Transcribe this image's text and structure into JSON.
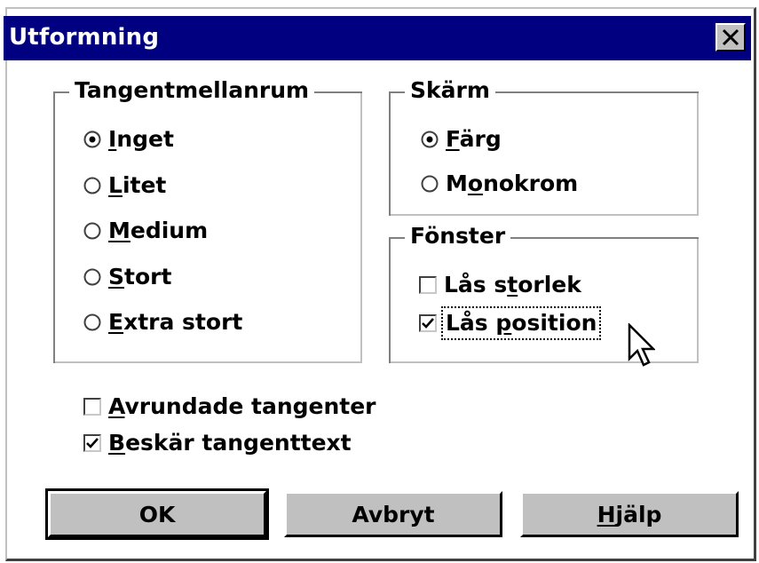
{
  "window": {
    "title": "Utformning",
    "close_label": "×",
    "close_icon": "close-x-icon"
  },
  "key_spacing": {
    "legend": "Tangentmellanrum",
    "options": [
      {
        "pre": "",
        "key": "I",
        "post": "nget",
        "selected": true
      },
      {
        "pre": "",
        "key": "L",
        "post": "itet",
        "selected": false
      },
      {
        "pre": "",
        "key": "M",
        "post": "edium",
        "selected": false
      },
      {
        "pre": "",
        "key": "S",
        "post": "tort",
        "selected": false
      },
      {
        "pre": "",
        "key": "E",
        "post": "xtra stort",
        "selected": false
      }
    ]
  },
  "screen": {
    "legend": "Skärm",
    "options": [
      {
        "pre": "",
        "key": "F",
        "post": "ärg",
        "selected": true
      },
      {
        "pre": "M",
        "key": "o",
        "post": "nokrom",
        "selected": false
      }
    ]
  },
  "window_group": {
    "legend": "Fönster",
    "options": [
      {
        "pre": "Lås s",
        "key": "t",
        "post": "orlek",
        "checked": false
      },
      {
        "pre": "Lås ",
        "key": "p",
        "post": "osition",
        "checked": true,
        "focused": true
      }
    ]
  },
  "checkboxes": [
    {
      "pre": "",
      "key": "A",
      "post": "vrundade tangenter",
      "checked": false
    },
    {
      "pre": "",
      "key": "B",
      "post": "eskär tangenttext",
      "checked": true
    }
  ],
  "buttons": {
    "ok": {
      "pre": "OK",
      "key": "",
      "post": ""
    },
    "cancel": {
      "pre": "Avbryt",
      "key": "",
      "post": ""
    },
    "help": {
      "pre": "",
      "key": "H",
      "post": "jälp"
    }
  },
  "colors": {
    "titlebar": "#000080",
    "face": "#c0c0c0",
    "background": "#ffffff"
  }
}
